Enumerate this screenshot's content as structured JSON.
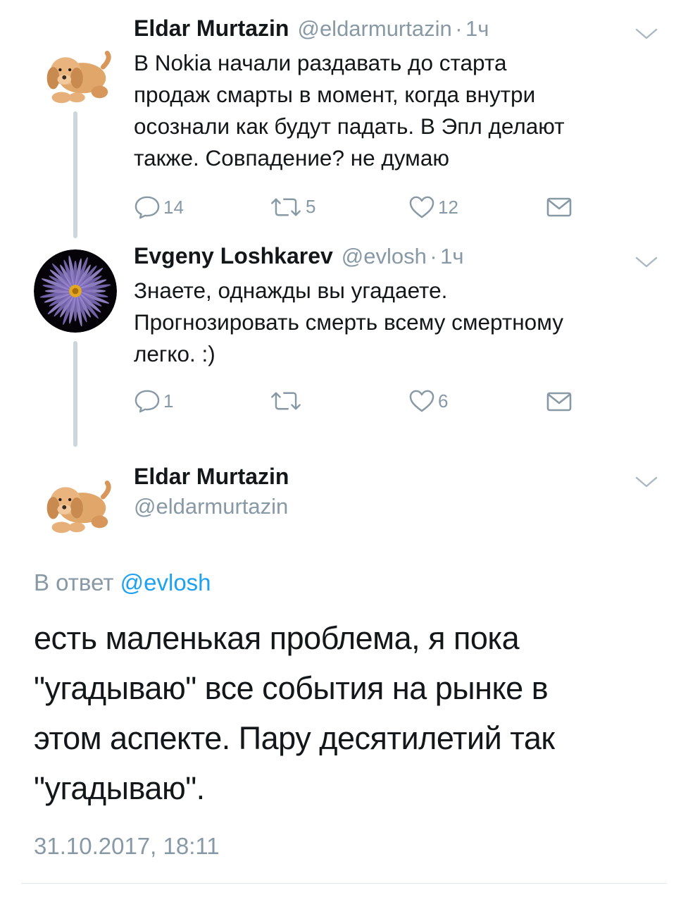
{
  "tweets": [
    {
      "name": "Eldar Murtazin",
      "handle": "@eldarmurtazin",
      "sep": "·",
      "time": "1ч",
      "avatar": "puppy-plush-avatar",
      "text": [
        "В Nokia начали раздавать до старта",
        "продаж смарты в момент, когда внутри",
        "осознали как будут падать. В Эпл делают",
        "также. Совпадение? не думаю"
      ],
      "replies": "14",
      "retweets": "5",
      "likes": "12"
    },
    {
      "name": "Evgeny Loshkarev",
      "handle": "@evlosh",
      "sep": "·",
      "time": "1ч",
      "avatar": "purple-flower-avatar",
      "text": [
        "Знаете, однажды вы угадаете.",
        "Прогнозировать смерть всему смертному",
        "легко. :)"
      ],
      "replies": "1",
      "retweets": "",
      "likes": "6"
    }
  ],
  "main_tweet": {
    "name": "Eldar Murtazin",
    "handle": "@eldarmurtazin",
    "avatar": "puppy-plush-avatar",
    "reply_prefix": "В ответ",
    "reply_mention": "@evlosh",
    "text": [
      "есть маленькая проблема, я пока",
      "\"угадываю\" все события на рынке в",
      "этом аспекте. Пару десятилетий так",
      "\"угадываю\"."
    ],
    "timestamp": "31.10.2017, 18:11"
  },
  "icons": {
    "reply": "reply-bubble-icon",
    "retweet": "retweet-icon",
    "like": "heart-icon",
    "dm": "envelope-icon",
    "more": "chevron-down-icon"
  },
  "colors": {
    "text": "#14171a",
    "secondary": "#8899a6",
    "link": "#1da1f2",
    "thread_line": "#ccd6dd"
  }
}
